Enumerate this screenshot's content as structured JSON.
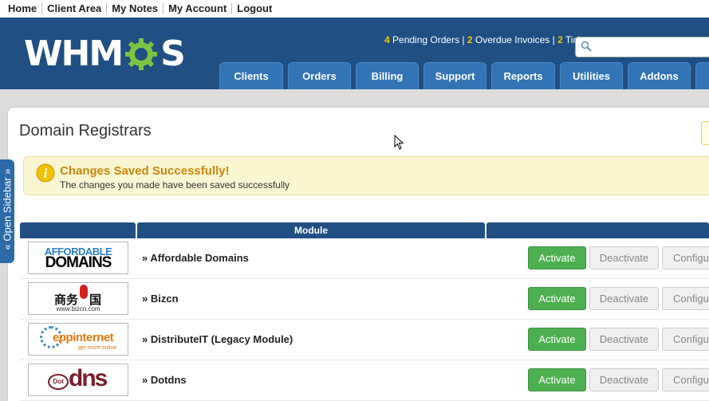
{
  "topnav": [
    "Home",
    "Client Area",
    "My Notes",
    "My Account",
    "Logout"
  ],
  "brand": {
    "logo_left": "WHM",
    "logo_right": "S",
    "gear_color": "#7dc242"
  },
  "stats": {
    "pending_count": "4",
    "pending_label": "Pending Orders",
    "overdue_count": "2",
    "overdue_label": "Overdue Invoices",
    "tickets_count": "2",
    "tickets_label": "Ticket"
  },
  "search": {
    "icon": "search-icon",
    "placeholder": ""
  },
  "tabs": [
    "Clients",
    "Orders",
    "Billing",
    "Support",
    "Reports",
    "Utilities",
    "Addons"
  ],
  "page": {
    "title": "Domain Registrars"
  },
  "sidebar": {
    "label": "« Open Sidebar »"
  },
  "alert": {
    "title": "Changes Saved Successfully!",
    "message": "The changes you made have been saved successfully",
    "icon": "info-icon"
  },
  "table": {
    "header_module": "Module",
    "rows": [
      {
        "name": "» Affordable Domains",
        "logo_line1": "AFFORDABLE",
        "logo_line2": "DOMAINS",
        "activate": "Activate",
        "deactivate": "Deactivate",
        "configure": "Configure"
      },
      {
        "name": "» Bizcn",
        "logo_line1": "商务",
        "logo_line2": "国",
        "logo_line3": "www.bizcn.com",
        "activate": "Activate",
        "deactivate": "Deactivate",
        "configure": "Configure"
      },
      {
        "name": "» DistributeIT (Legacy Module)",
        "logo_line1": "eppinternet",
        "logo_line2": "get more online",
        "activate": "Activate",
        "deactivate": "Deactivate",
        "configure": "Configure"
      },
      {
        "name": "» Dotdns",
        "logo_line1": "Dot",
        "logo_line2": "dns",
        "activate": "Activate",
        "deactivate": "Deactivate",
        "configure": "Configure"
      }
    ]
  },
  "colors": {
    "header_bg": "#204f83",
    "tab_bg": "#3274b6",
    "activate_green": "#4caf50",
    "stat_yellow": "#f5c400",
    "alert_title": "#c8870a"
  }
}
